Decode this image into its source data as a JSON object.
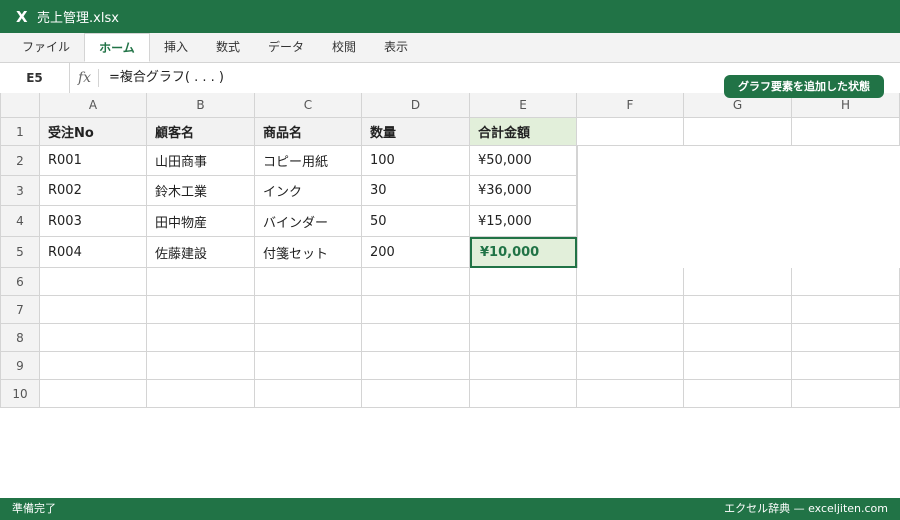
{
  "app": {
    "icon": "excel-icon",
    "file_name": "売上管理.xlsx"
  },
  "ribbon": {
    "tabs": [
      "ファイル",
      "ホーム",
      "挿入",
      "数式",
      "データ",
      "校閲",
      "表示"
    ],
    "active_tab": "ホーム"
  },
  "formula_bar": {
    "name_box": "E5",
    "fx_label": "fx",
    "formula": "=複合グラフ( . . . )"
  },
  "badge": "グラフ要素を追加した状態",
  "sheet": {
    "columns": [
      "A",
      "B",
      "C",
      "D",
      "E",
      "F",
      "G",
      "H"
    ],
    "rows": [
      "1",
      "2",
      "3",
      "4",
      "5",
      "6",
      "7",
      "8",
      "9",
      "10"
    ],
    "headers": [
      "受注No",
      "顧客名",
      "商品名",
      "数量",
      "合計金額"
    ],
    "data": [
      [
        "R001",
        "山田商事",
        "コピー用紙",
        "100",
        "¥50,000"
      ],
      [
        "R002",
        "鈴木工業",
        "インク",
        "30",
        "¥36,000"
      ],
      [
        "R003",
        "田中物産",
        "バインダー",
        "50",
        "¥15,000"
      ],
      [
        "R004",
        "佐藤建設",
        "付箋セット",
        "200",
        "¥10,000"
      ]
    ],
    "selected_cell": "E5"
  },
  "status_bar": {
    "left": "準備完了",
    "right": "エクセル辞典 — exceljiten.com"
  },
  "colors": {
    "accent": "#217346",
    "selected_fill": "#e2efda"
  }
}
